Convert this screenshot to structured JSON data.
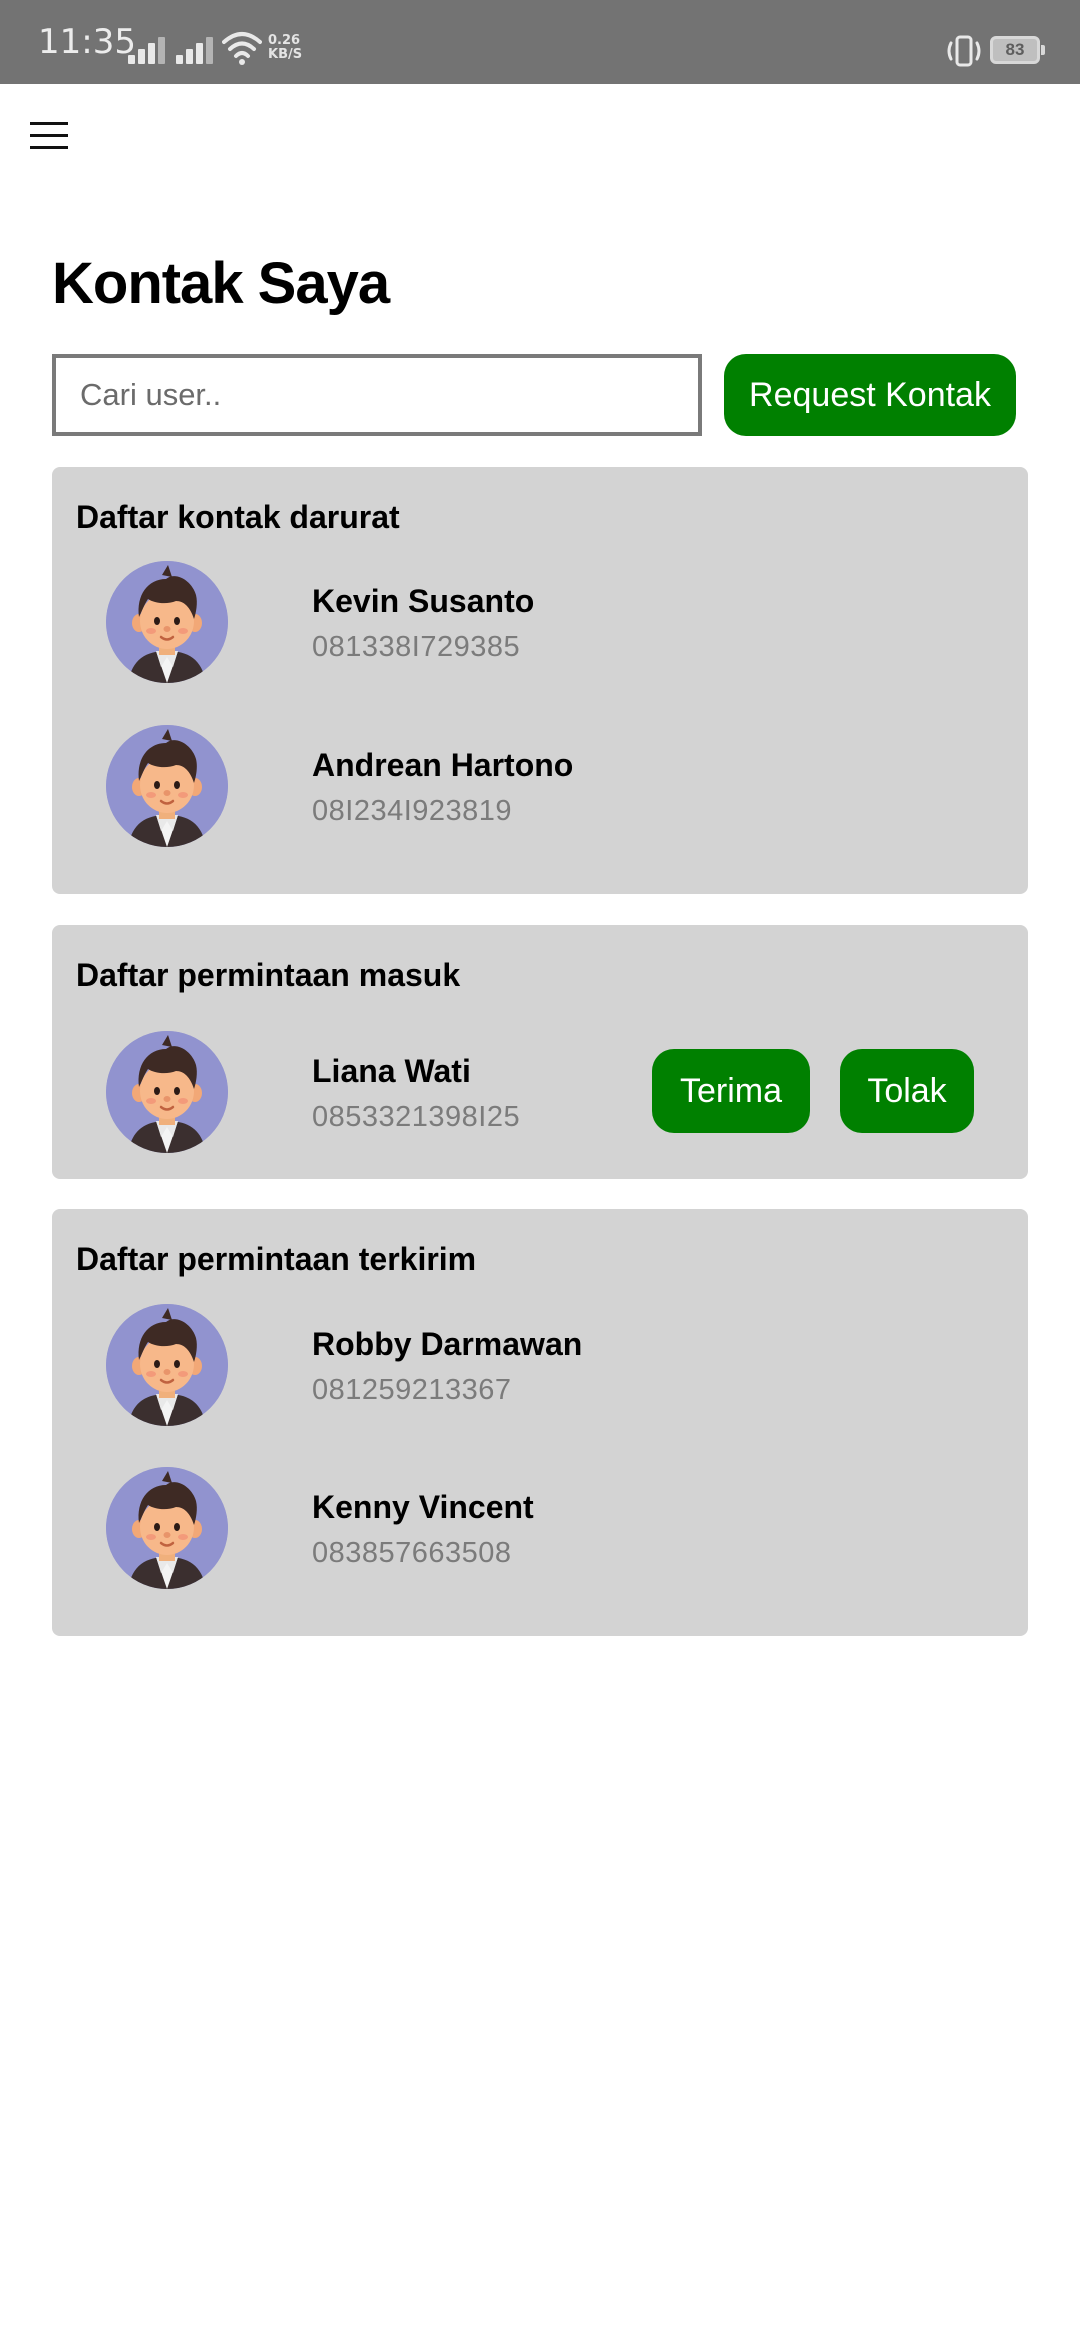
{
  "status_bar": {
    "time": "11:35",
    "net_speed_value": "0.26",
    "net_speed_unit": "KB/S",
    "battery": "83",
    "icons": [
      "signal-icon",
      "signal-icon",
      "wifi-icon",
      "vibrate-icon",
      "battery-icon"
    ]
  },
  "header": {
    "menu_icon": "hamburger-menu-icon",
    "title": "Kontak Saya"
  },
  "search": {
    "placeholder": "Cari user..",
    "value": ""
  },
  "request_button_label": "Request Kontak",
  "accent_color": "#008000",
  "card_color": "#d3d3d3",
  "sections": {
    "emergency": {
      "title": "Daftar kontak darurat",
      "contacts": [
        {
          "name": "Kevin Susanto",
          "phone": "081338I729385"
        },
        {
          "name": "Andrean Hartono",
          "phone": "08I234I923819"
        }
      ]
    },
    "incoming": {
      "title": "Daftar permintaan masuk",
      "contacts": [
        {
          "name": "Liana Wati",
          "phone": "0853321398I25",
          "accept_label": "Terima",
          "reject_label": "Tolak"
        }
      ]
    },
    "sent": {
      "title": "Daftar permintaan terkirim",
      "contacts": [
        {
          "name": "Robby Darmawan",
          "phone": "081259213367"
        },
        {
          "name": "Kenny Vincent",
          "phone": "083857663508"
        }
      ]
    }
  }
}
